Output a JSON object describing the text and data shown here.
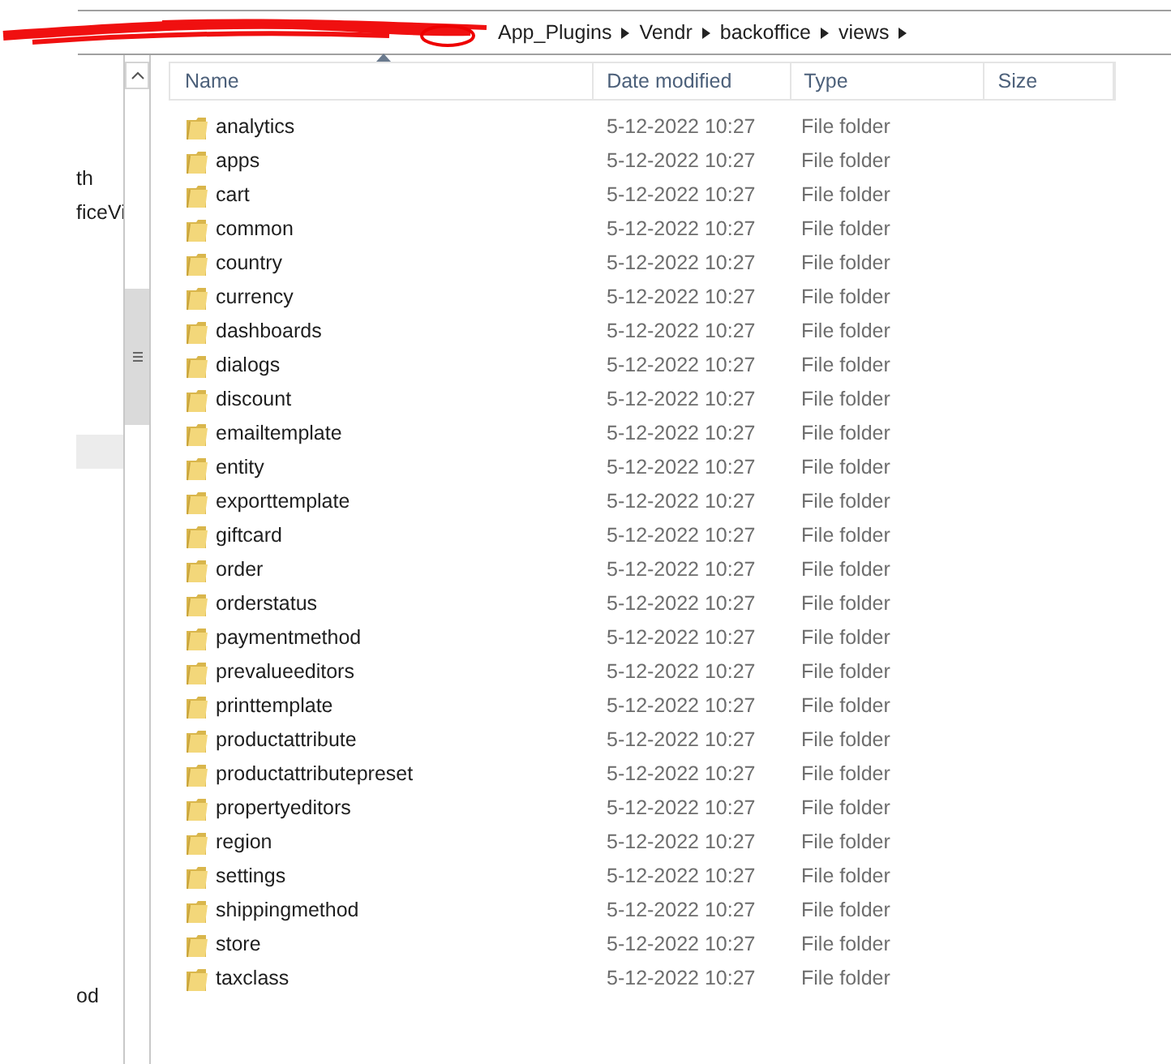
{
  "address_bar": {
    "redacted": true,
    "segments": [
      "App_Plugins",
      "Vendr",
      "backoffice",
      "views"
    ]
  },
  "nav_pane": {
    "items": [
      {
        "label": "th"
      },
      {
        "label": "ficeVi"
      },
      {
        "label": "od"
      }
    ],
    "highlighted_row": true
  },
  "columns": [
    {
      "label": "Name",
      "sorted": true
    },
    {
      "label": "Date modified",
      "sorted": false
    },
    {
      "label": "Type",
      "sorted": false
    },
    {
      "label": "Size",
      "sorted": false
    }
  ],
  "rows": [
    {
      "name": "analytics",
      "date": "5-12-2022 10:27",
      "type": "File folder"
    },
    {
      "name": "apps",
      "date": "5-12-2022 10:27",
      "type": "File folder"
    },
    {
      "name": "cart",
      "date": "5-12-2022 10:27",
      "type": "File folder"
    },
    {
      "name": "common",
      "date": "5-12-2022 10:27",
      "type": "File folder"
    },
    {
      "name": "country",
      "date": "5-12-2022 10:27",
      "type": "File folder"
    },
    {
      "name": "currency",
      "date": "5-12-2022 10:27",
      "type": "File folder"
    },
    {
      "name": "dashboards",
      "date": "5-12-2022 10:27",
      "type": "File folder"
    },
    {
      "name": "dialogs",
      "date": "5-12-2022 10:27",
      "type": "File folder"
    },
    {
      "name": "discount",
      "date": "5-12-2022 10:27",
      "type": "File folder"
    },
    {
      "name": "emailtemplate",
      "date": "5-12-2022 10:27",
      "type": "File folder"
    },
    {
      "name": "entity",
      "date": "5-12-2022 10:27",
      "type": "File folder"
    },
    {
      "name": "exporttemplate",
      "date": "5-12-2022 10:27",
      "type": "File folder"
    },
    {
      "name": "giftcard",
      "date": "5-12-2022 10:27",
      "type": "File folder"
    },
    {
      "name": "order",
      "date": "5-12-2022 10:27",
      "type": "File folder"
    },
    {
      "name": "orderstatus",
      "date": "5-12-2022 10:27",
      "type": "File folder"
    },
    {
      "name": "paymentmethod",
      "date": "5-12-2022 10:27",
      "type": "File folder"
    },
    {
      "name": "prevalueeditors",
      "date": "5-12-2022 10:27",
      "type": "File folder"
    },
    {
      "name": "printtemplate",
      "date": "5-12-2022 10:27",
      "type": "File folder"
    },
    {
      "name": "productattribute",
      "date": "5-12-2022 10:27",
      "type": "File folder"
    },
    {
      "name": "productattributepreset",
      "date": "5-12-2022 10:27",
      "type": "File folder"
    },
    {
      "name": "propertyeditors",
      "date": "5-12-2022 10:27",
      "type": "File folder"
    },
    {
      "name": "region",
      "date": "5-12-2022 10:27",
      "type": "File folder"
    },
    {
      "name": "settings",
      "date": "5-12-2022 10:27",
      "type": "File folder"
    },
    {
      "name": "shippingmethod",
      "date": "5-12-2022 10:27",
      "type": "File folder"
    },
    {
      "name": "store",
      "date": "5-12-2022 10:27",
      "type": "File folder"
    },
    {
      "name": "taxclass",
      "date": "5-12-2022 10:27",
      "type": "File folder"
    }
  ]
}
